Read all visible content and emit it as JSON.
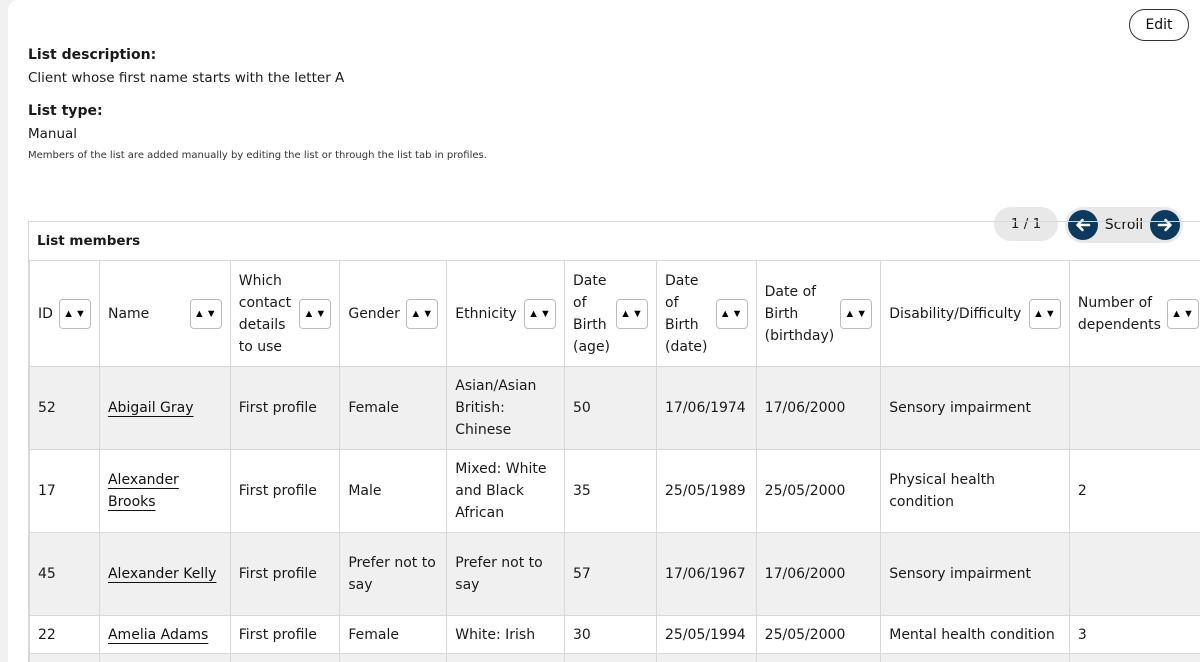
{
  "header": {
    "edit_label": "Edit",
    "description_title": "List description:",
    "description_text": "Client whose first name starts with the letter A",
    "type_title": "List type:",
    "type_text": "Manual",
    "type_note": "Members of the list are added manually by editing the list or through the list tab in profiles."
  },
  "members": {
    "title": "List members",
    "page_indicator": "1 / 1",
    "scroll_label": "Scroll",
    "sort_icon": "▲▼",
    "columns": [
      "ID",
      "Name",
      "Which contact details to use",
      "Gender",
      "Ethnicity",
      "Date of Birth (age)",
      "Date of Birth (date)",
      "Date of Birth (birthday)",
      "Disability/Difficulty",
      "Number of dependents"
    ],
    "rows": [
      [
        "52",
        "Abigail Gray",
        "First profile",
        "Female",
        "Asian/Asian British: Chinese",
        "50",
        "17/06/1974",
        "17/06/2000",
        "Sensory impairment",
        ""
      ],
      [
        "17",
        "Alexander Brooks",
        "First profile",
        "Male",
        "Mixed: White and Black African",
        "35",
        "25/05/1989",
        "25/05/2000",
        "Physical health condition",
        "2"
      ],
      [
        "45",
        "Alexander Kelly",
        "First profile",
        "Prefer not to say",
        "Prefer not to say",
        "57",
        "17/06/1967",
        "17/06/2000",
        "Sensory impairment",
        ""
      ],
      [
        "22",
        "Amelia Adams",
        "First profile",
        "Female",
        "White: Irish",
        "30",
        "25/05/1994",
        "25/05/2000",
        "Mental health condition",
        "3"
      ]
    ]
  },
  "colors": {
    "accent": "#0c3a5e",
    "row_alt": "#f0f0f0",
    "border": "#d8d8d8"
  }
}
